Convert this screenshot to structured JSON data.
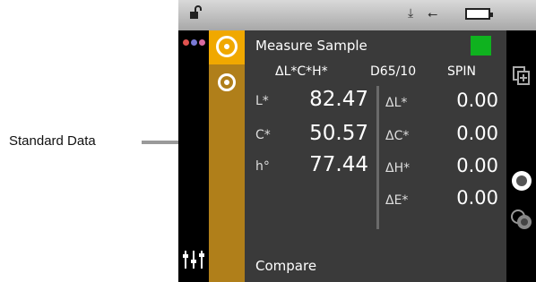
{
  "callout": {
    "label": "Standard Data"
  },
  "screen": {
    "title": "Measure Sample",
    "sample_color": "#0fb21f",
    "header": {
      "mode": "ΔL*C*H*",
      "illuminant": "D65/10",
      "spin": "SPIN"
    },
    "standard": [
      {
        "label": "L*",
        "value": "82.47"
      },
      {
        "label": "C*",
        "value": "50.57"
      },
      {
        "label": "h°",
        "value": "77.44"
      }
    ],
    "deltas": [
      {
        "label": "ΔL*",
        "value": "0.00"
      },
      {
        "label": "ΔC*",
        "value": "0.00"
      },
      {
        "label": "ΔH*",
        "value": "0.00"
      },
      {
        "label": "ΔE*",
        "value": "0.00"
      }
    ],
    "footer": "Compare"
  },
  "icons": {
    "status": [
      "lock-icon",
      "download-icon",
      "usb-icon",
      "battery-icon"
    ],
    "left": [
      "menu-dots-icon",
      "settings-sliders-icon"
    ],
    "tools": [
      "target-icon",
      "target-small-icon"
    ],
    "right": [
      "copy-icon",
      "measure-icon",
      "multi-measure-icon"
    ]
  },
  "colors": {
    "accent": "#f0a800",
    "tool_column": "#b07f1a",
    "panel": "#3a3a3a",
    "dot1": "#e0524f",
    "dot2": "#7a7ad6",
    "dot3": "#d86aa0"
  }
}
